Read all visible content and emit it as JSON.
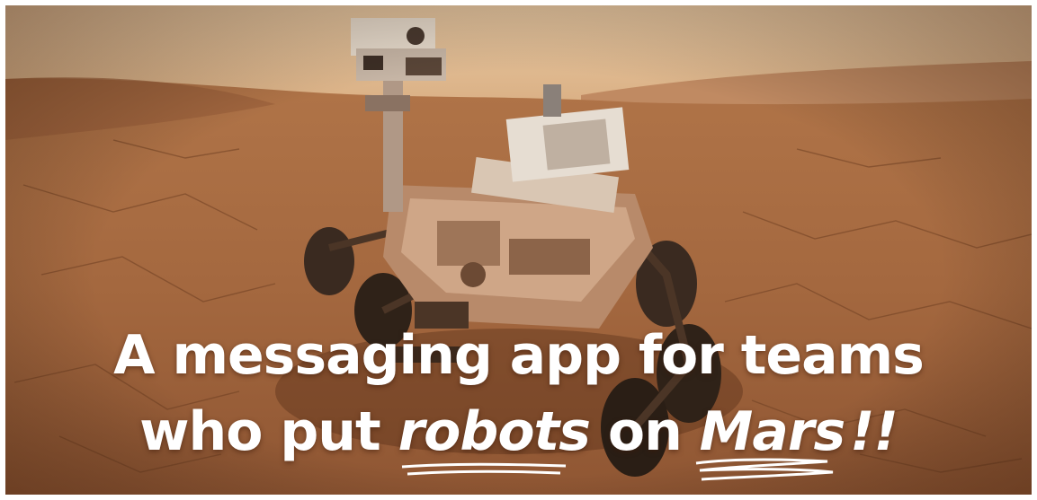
{
  "hero": {
    "image_subject": "rover-on-mars",
    "headline_line1": "A messaging app for teams",
    "headline_line2_prefix": "who put ",
    "headline_emph1": "robots",
    "headline_mid": " on ",
    "headline_emph2": "Mars",
    "headline_suffix": "!!"
  }
}
